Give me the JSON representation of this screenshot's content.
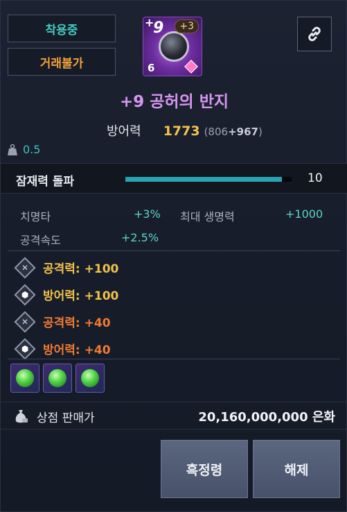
{
  "tags": {
    "equipped": "착용중",
    "untradable": "거래불가"
  },
  "item_icon": {
    "plus": "+",
    "enhance": "9",
    "bonus": "+3",
    "tier": "6"
  },
  "item_name": "+9 공허의 반지",
  "defense": {
    "label": "방어력",
    "total": "1773",
    "base": "(806",
    "bonus": "+967",
    "close": ")"
  },
  "weight": "0.5",
  "potential": {
    "label": "잠재력 돌파",
    "value": "10",
    "fill": 0.94
  },
  "stats": [
    {
      "label": "치명타",
      "value": "+3%"
    },
    {
      "label": "최대 생명력",
      "value": "+1000"
    },
    {
      "label": "공격속도",
      "value": "+2.5%"
    }
  ],
  "engravings": [
    {
      "text": "공격력: +100",
      "color": "yellow",
      "icon": "swords-icon"
    },
    {
      "text": "방어력: +100",
      "color": "yellow",
      "icon": "shield-icon"
    },
    {
      "text": "공격력: +40",
      "color": "orange",
      "icon": "swords-icon"
    },
    {
      "text": "방어력: +40",
      "color": "orange",
      "icon": "shield-icon"
    }
  ],
  "gems": [
    "green-gem",
    "green-gem",
    "green-gem"
  ],
  "sell": {
    "label": "상점 판매가",
    "value": "20,160,000,000 은화"
  },
  "buttons": {
    "extract": "흑정령",
    "release": "해제"
  },
  "colors": {
    "name": "#d695f0",
    "accent": "#29a3b4",
    "gold": "#f2c44a",
    "orange": "#f07a35"
  }
}
